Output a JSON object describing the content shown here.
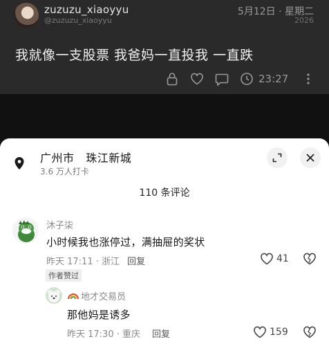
{
  "post": {
    "username": "zuzuzu_xiaoyyu",
    "handle": "@zuzuzu_xiaoyyu",
    "date": "5月12日 · 星期二",
    "year": "2026",
    "text": "我就像一支股票 我爸妈一直投我 一直跌",
    "time": "23:27",
    "icons": [
      "lock-icon",
      "heart-icon",
      "comment-icon",
      "clock-icon",
      "more-icon"
    ]
  },
  "location": {
    "name": "广州市   珠江新城",
    "checkins": "3.6 万人打卡",
    "icon": "map-pin-icon"
  },
  "comments_header": "110 条评论",
  "comments": [
    {
      "author": "沐子柒",
      "text": "小时候我也涨停过，满抽屉的奖状",
      "meta": "昨天 17:11 · 浙江",
      "reply_label": "回复",
      "likes": "41",
      "badge": "作者赞过",
      "avatar_icon": "dinosaur-avatar"
    },
    {
      "author": "地才交易员",
      "author_prefix_icon": "rainbow-icon",
      "text": "那他妈是诱多",
      "meta": "昨天 17:30 · 重庆",
      "reply_label": "回复",
      "likes": "159",
      "avatar_icon": "bear-avatar"
    }
  ],
  "colors": {
    "background": "#111111",
    "post_card": "#2a2a2a",
    "sheet": "#ffffff"
  }
}
